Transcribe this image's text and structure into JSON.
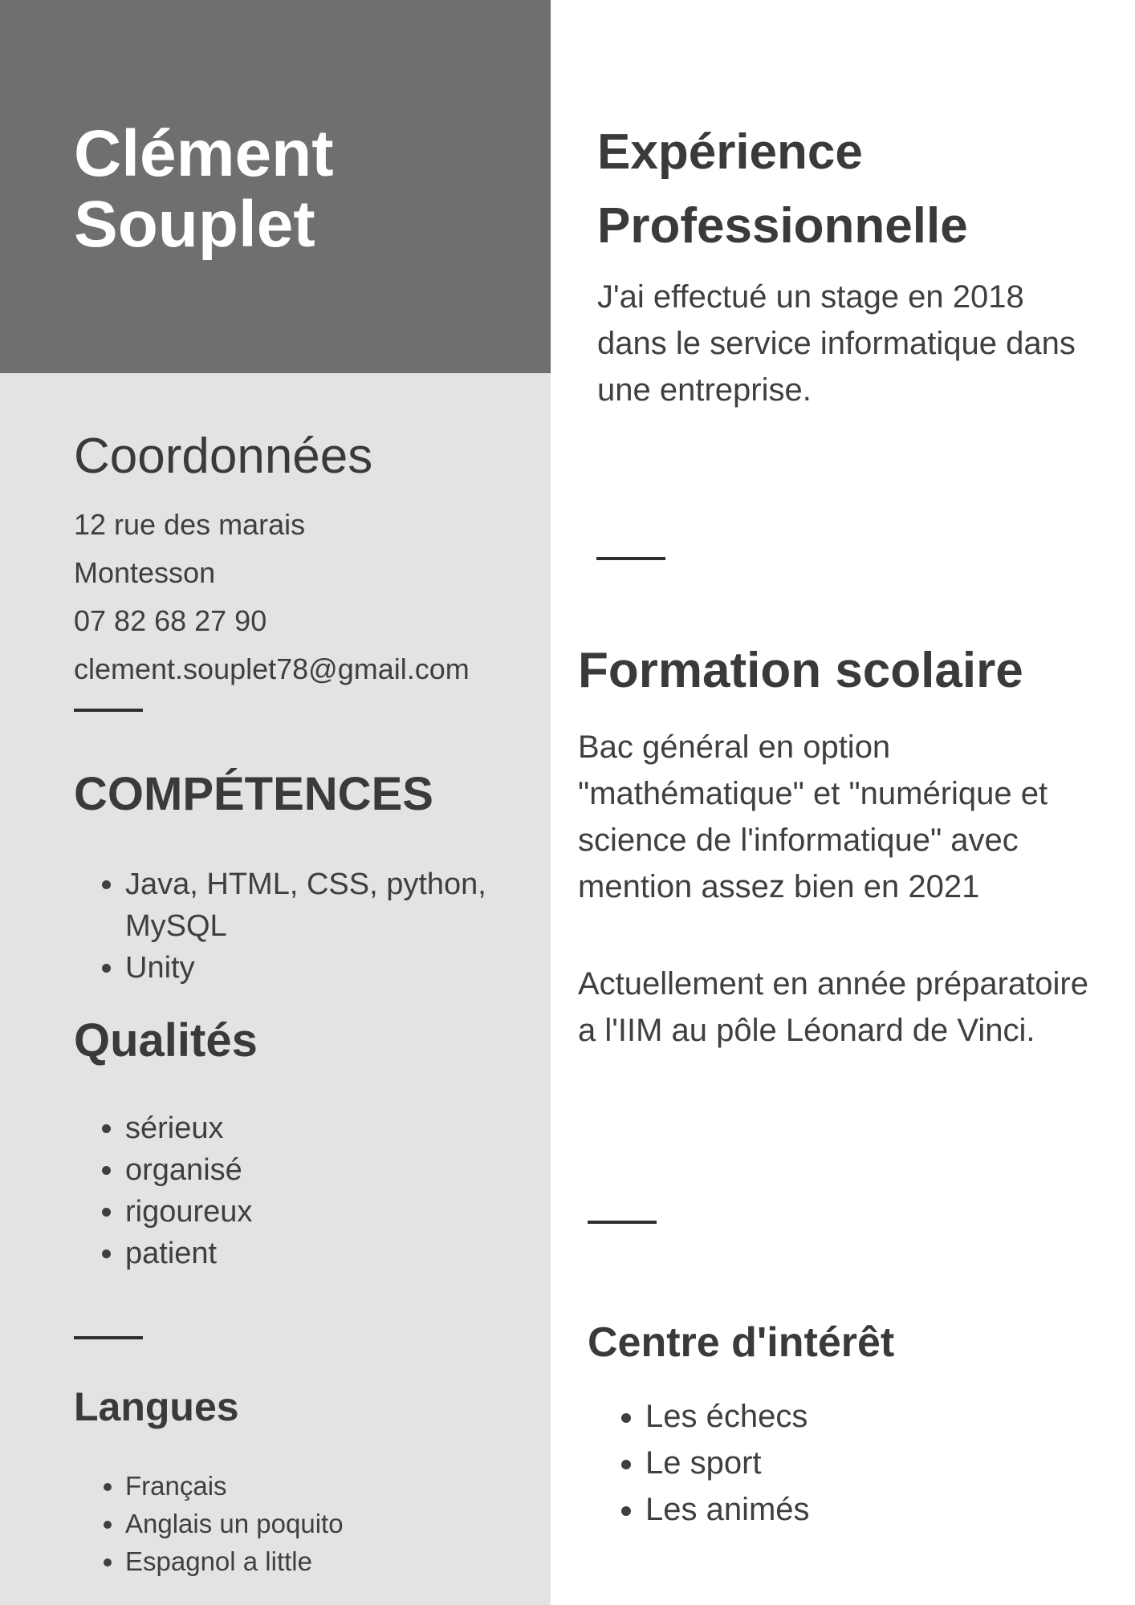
{
  "header": {
    "first_name": "Clément",
    "last_name": "Souplet"
  },
  "coordonnees": {
    "title": "Coordonnées",
    "address": "12 rue des marais",
    "city": "Montesson",
    "phone": "07 82 68 27 90",
    "email": "clement.souplet78@gmail.com"
  },
  "competences": {
    "title": "COMPÉTENCES",
    "items": [
      "Java, HTML, CSS, python, MySQL",
      "Unity"
    ]
  },
  "qualites": {
    "title": "Qualités",
    "items": [
      "sérieux",
      "organisé",
      "rigoureux",
      "patient"
    ]
  },
  "langues": {
    "title": "Langues",
    "items": [
      "Français",
      "Anglais un poquito",
      "Espagnol a little"
    ]
  },
  "experience": {
    "title": "Expérience Professionnelle",
    "text": "J'ai effectué un stage en 2018 dans le service informatique dans une entreprise."
  },
  "formation": {
    "title": "Formation scolaire",
    "paragraph1": "Bac général en option \"mathématique\" et \"numérique et science de l'informatique\" avec mention assez bien en 2021",
    "paragraph2": "Actuellement en année préparatoire a l'IIM au pôle Léonard de Vinci."
  },
  "centre_interet": {
    "title": "Centre d'intérêt",
    "items": [
      "Les échecs",
      "Le sport",
      "Les animés"
    ]
  },
  "colors": {
    "header_block": "#6f6f6f",
    "sidebar": "#e3e3e3",
    "text": "#3a3a3a"
  }
}
